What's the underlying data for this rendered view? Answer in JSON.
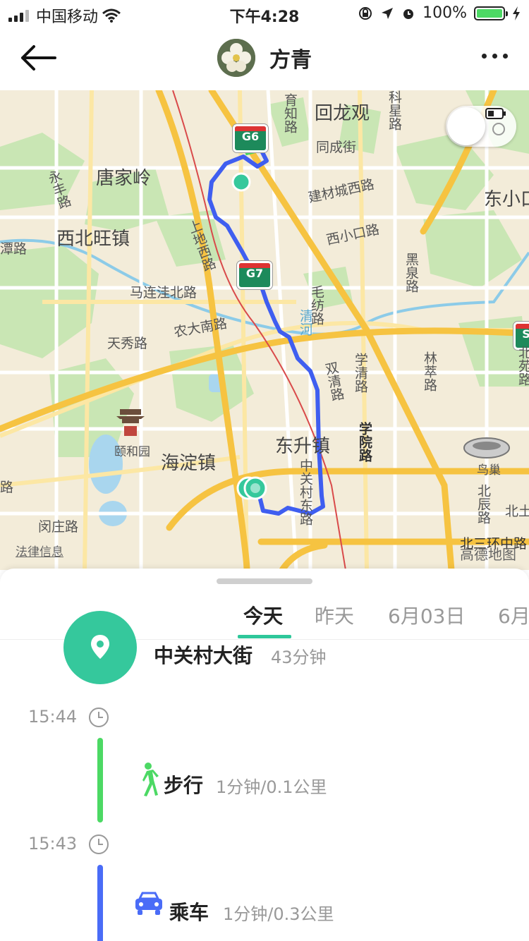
{
  "status_bar": {
    "carrier": "中国移动",
    "time": "下午4:28",
    "battery": "100%"
  },
  "nav": {
    "title": "方青"
  },
  "map": {
    "labels": {
      "huilongguan": "回龙观",
      "yuzhi_rd": "育知路",
      "kexing_rd": "科星路",
      "tongcheng_st": "同成街",
      "tangjialing": "唐家岭",
      "jiancai_cheng_w_rd": "建材城西路",
      "dongxiao": "东小口",
      "yongfeng_rd": "永丰路",
      "xibeiwang": "西北旺镇",
      "tan_rd": "潭路",
      "shangdi_w_rd": "上地西路",
      "xixiaokou_rd": "西小口路",
      "heiquan_rd": "黑泉路",
      "malianwa_n_rd": "马连洼北路",
      "maofang_rd": "毛纺路",
      "nongda_s_rd": "农大南路",
      "tianxiu_rd": "天秀路",
      "qinghe": "清河",
      "xueqing_rd": "学清路",
      "linsui_rd": "林萃路",
      "bei_rd": "北苑路",
      "shuangqing_rd": "双清路",
      "yiheyuan": "颐和园",
      "dongsheng": "东升镇",
      "xueyuan_rd": "学院路",
      "bird_nest": "鸟巢",
      "haidian": "海淀镇",
      "zhongguancun_e_rd": "中关村东路",
      "beichen_rd": "北辰路",
      "beitu": "北土",
      "road_lu": "路",
      "yizhuang_rd": "闵庄路",
      "n3ring_mid": "北三环中路"
    },
    "shields": {
      "g6": "G6",
      "g7": "G7",
      "s": "S"
    },
    "legal": "法律信息",
    "provider": "高德地图"
  },
  "tabs": [
    {
      "label": "今天"
    },
    {
      "label": "昨天"
    },
    {
      "label": "6月03日"
    },
    {
      "label": "6月"
    }
  ],
  "timeline": {
    "stop": {
      "place": "中关村大街",
      "duration": "43分钟"
    },
    "segments": [
      {
        "time": "15:44",
        "mode": "步行",
        "detail": "1分钟/0.1公里",
        "color": "#4cd964",
        "icon": "walk-icon"
      },
      {
        "time": "15:43",
        "mode": "乘车",
        "detail": "1分钟/0.3公里",
        "color": "#4a6cf7",
        "icon": "car-icon"
      }
    ]
  },
  "colors": {
    "accent": "#2ec79a",
    "route": "#3f5ef0",
    "walk": "#4cd964",
    "drive": "#4a6cf7"
  }
}
